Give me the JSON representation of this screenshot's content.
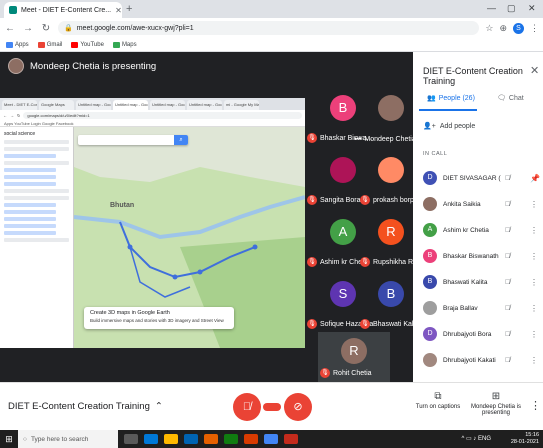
{
  "browser": {
    "tab_title": "Meet - DIET E-Content Cre...",
    "url": "meet.google.com/awe-xucx-gwj?pli=1",
    "profile_letter": "S",
    "bookmarks": [
      "Apps",
      "Gmail",
      "YouTube",
      "Maps"
    ]
  },
  "stage": {
    "presenting_text": "Mondeep Chetia is presenting"
  },
  "shared_screen": {
    "inner_tabs": [
      "Meet - DIET E-Conten...",
      "Google Maps",
      "Untitled map - Googl...",
      "Untitled map - Googl...",
      "Untitled map - Googl...",
      "Untitled map - Googl...",
      "mi - Google My Maps"
    ],
    "inner_url": "google.com/maps/d/u/0/edit?mid=1",
    "inner_bookmarks": "Apps  YouTube  Login  Google  Facebook",
    "map_panel_title": "social science",
    "map_region_label": "Bhutan",
    "map_popup_title": "Create 3D maps in Google Earth",
    "map_popup_text": "Build immersive maps and stories with 3D imagery and Street View"
  },
  "tiles": [
    {
      "name": "Bhaskar Biswa...",
      "initial": "B",
      "color": "#ec407a",
      "muted": true
    },
    {
      "name": "Mondeep Chetia",
      "initial": "",
      "color": "#8d6e63",
      "muted": false
    },
    {
      "name": "Sangita Bora",
      "initial": "",
      "color": "#ad1457",
      "muted": true
    },
    {
      "name": "prokash borpuz...",
      "initial": "",
      "color": "#ff8a65",
      "muted": true
    },
    {
      "name": "Ashim kr Chetia",
      "initial": "A",
      "color": "#43a047",
      "muted": true
    },
    {
      "name": "Rupshikha Rs",
      "initial": "R",
      "color": "#f4511e",
      "muted": true
    },
    {
      "name": "Sofique Hazarika",
      "initial": "S",
      "color": "#5e35b1",
      "muted": true
    },
    {
      "name": "Bhaswati Kalita",
      "initial": "B",
      "color": "#3949ab",
      "muted": true
    },
    {
      "name": "Rohit Chetia",
      "initial": "R",
      "color": "#8d6e63",
      "muted": true
    }
  ],
  "bottom": {
    "meeting_title": "DIET E-Content Creation Training",
    "captions_label": "Turn on captions",
    "presenting_label": "Mondeep Chetia is presenting"
  },
  "panel": {
    "title": "DIET E-Content Creation Training",
    "tab_people": "People (26)",
    "tab_chat": "Chat",
    "add_people": "Add people",
    "in_call": "IN CALL",
    "people": [
      {
        "name": "DIET SIVASAGAR (You)",
        "initial": "D",
        "color": "#3f51b5"
      },
      {
        "name": "Ankita Saikia",
        "initial": "",
        "color": "#8d6e63"
      },
      {
        "name": "Ashim kr Chetia",
        "initial": "A",
        "color": "#43a047"
      },
      {
        "name": "Bhaskar Biswanath",
        "initial": "B",
        "color": "#ec407a"
      },
      {
        "name": "Bhaswati Kalita",
        "initial": "B",
        "color": "#3949ab"
      },
      {
        "name": "Braja Ballav",
        "initial": "",
        "color": "#9e9e9e"
      },
      {
        "name": "Dhrubajyoti Bora",
        "initial": "D",
        "color": "#7e57c2"
      },
      {
        "name": "Dhrubajyoti Kakati",
        "initial": "",
        "color": "#a1887f"
      }
    ]
  },
  "taskbar": {
    "search_placeholder": "Type here to search",
    "language": "ENG",
    "time": "15:16",
    "date": "28-01-2021"
  }
}
